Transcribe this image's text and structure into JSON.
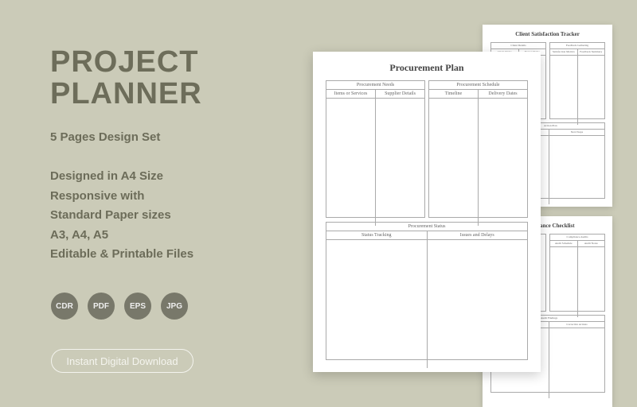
{
  "promo": {
    "title_line1": "PROJECT",
    "title_line2": "PLANNER",
    "subtitle": "5 Pages Design Set",
    "features": [
      "Designed in A4 Size",
      "Responsive with",
      "Standard Paper sizes",
      "A3, A4, A5",
      "Editable & Printable Files"
    ],
    "formats": [
      "CDR",
      "PDF",
      "EPS",
      "JPG"
    ],
    "download_label": "Instant Digital Download"
  },
  "pages": {
    "main": {
      "title": "Procurement Plan",
      "needs": {
        "header": "Procurement Needs",
        "cols": [
          "Items or Services",
          "Supplier Details"
        ]
      },
      "schedule": {
        "header": "Procurement Schedule",
        "cols": [
          "Timeline",
          "Delivery Dates"
        ]
      },
      "status": {
        "header": "Procurement Status",
        "cols": [
          "Status Tracking",
          "Issues and Delays"
        ]
      }
    },
    "back1": {
      "title": "Client Satisfaction Tracker",
      "details": {
        "header": "Client Details",
        "cols": [
          "Client Name",
          "Project Name"
        ]
      },
      "feedback": {
        "header": "Feedback Gathering",
        "cols": [
          "Satisfaction Metrics",
          "Feedback Summary"
        ]
      },
      "action": {
        "header": "Action Plan",
        "cols": [
          "Next Steps"
        ]
      }
    },
    "back2": {
      "title": "Compliance Checklist",
      "audits": {
        "header": "Compliance Audits",
        "cols": [
          "Audit Schedule",
          "Audit Notes"
        ]
      },
      "findings": {
        "header": "Audit Findings",
        "cols": [
          "Corrective Actions"
        ]
      }
    }
  },
  "colors": {
    "background": "#cbcbb8",
    "text": "#6c6c59",
    "badge": "#78786a"
  }
}
